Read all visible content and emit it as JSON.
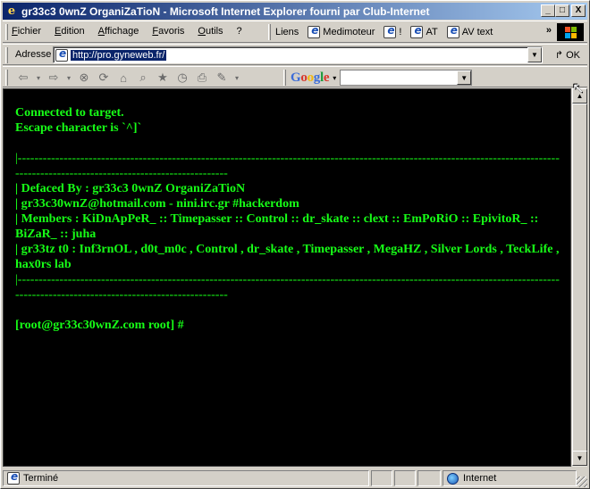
{
  "window": {
    "title": "gr33c3 0wnZ OrganiZaTioN - Microsoft Internet Explorer fourni par Club-Internet",
    "buttons": [
      "_",
      "□",
      "X"
    ]
  },
  "menubar": {
    "items": [
      "Fichier",
      "Edition",
      "Affichage",
      "Favoris",
      "Outils",
      "?"
    ]
  },
  "links": {
    "label": "Liens",
    "items": [
      "Medimoteur",
      "!",
      "AT",
      "AV text"
    ],
    "more": "»"
  },
  "address": {
    "label": "Adresse",
    "url": "http://pro.gyneweb.fr/",
    "go_label": "OK"
  },
  "google": {
    "logo": "Google"
  },
  "terminal": {
    "line1": "Connected to target.",
    "line2": "Escape character is `^]`",
    "separator": "|-------------------------------------------------------------------------------------------------------------------------------------------------------------------------------------",
    "defaced": "|  Defaced By : gr33c3 0wnZ OrganiZaTioN",
    "contact": "|  gr33c30wnZ@hotmail.com - nini.irc.gr #hackerdom",
    "members": "|  Members : KiDnApPeR_ :: Timepasser :: Control :: dr_skate :: clext :: EmPoRiO :: EpivitoR_ :: BiZaR_ :: juha",
    "greetz": "|  gr33tz t0 : Inf3rnOL , d0t_m0c , Control , dr_skate , Timepasser , MegaHZ , Silver Lords , TeckLife , hax0rs lab",
    "separator2": "|-------------------------------------------------------------------------------------------------------------------------------------------------------------------------------------",
    "prompt": "[root@gr33c30wnZ.com root] #"
  },
  "status": {
    "text": "Terminé",
    "zone": "Internet"
  },
  "colors": {
    "terminal_text": "#17ff17",
    "terminal_bg": "#000000"
  }
}
